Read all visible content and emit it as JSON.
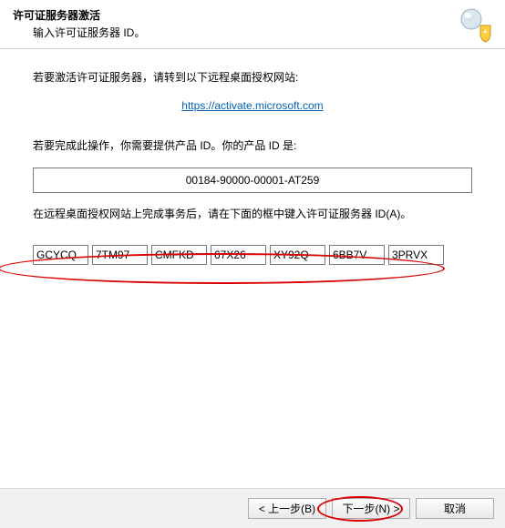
{
  "header": {
    "title": "许可证服务器激活",
    "subtitle": "输入许可证服务器 ID。"
  },
  "content": {
    "activate_prompt": "若要激活许可证服务器，请转到以下远程桌面授权网站:",
    "link_text": "https://activate.microsoft.com",
    "product_id_prompt": "若要完成此操作，你需要提供产品 ID。你的产品 ID 是:",
    "product_id_value": "00184-90000-00001-AT259",
    "server_id_prompt": "在远程桌面授权网站上完成事务后，请在下面的框中键入许可证服务器 ID(A)。"
  },
  "server_id_fields": [
    "GCYCQ",
    "7TM97",
    "CMFKD",
    "67X26",
    "XY92Q",
    "6BB7V",
    "3PRVX"
  ],
  "footer": {
    "back_label": "< 上一步(B)",
    "next_label": "下一步(N) >",
    "cancel_label": "取消"
  }
}
